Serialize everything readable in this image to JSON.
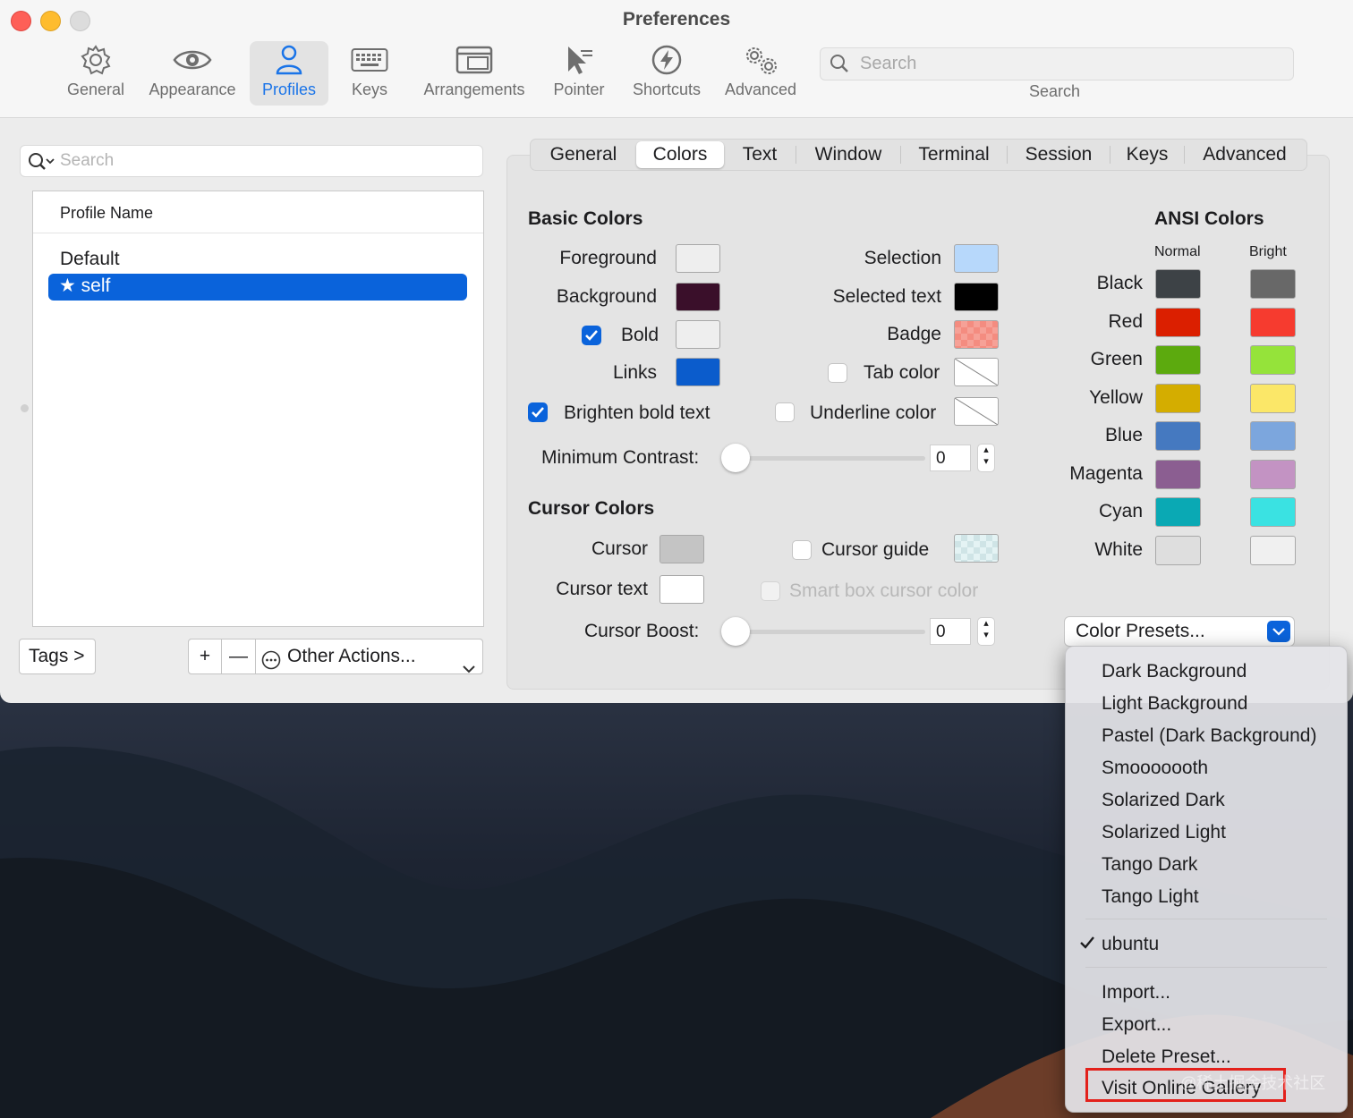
{
  "window": {
    "title": "Preferences"
  },
  "toolbar": {
    "items": [
      {
        "label": "General",
        "icon": "gear-icon"
      },
      {
        "label": "Appearance",
        "icon": "eye-icon"
      },
      {
        "label": "Profiles",
        "icon": "person-icon",
        "active": true
      },
      {
        "label": "Keys",
        "icon": "keyboard-icon"
      },
      {
        "label": "Arrangements",
        "icon": "window-icon"
      },
      {
        "label": "Pointer",
        "icon": "pointer-icon"
      },
      {
        "label": "Shortcuts",
        "icon": "lightning-icon"
      },
      {
        "label": "Advanced",
        "icon": "gears-icon"
      }
    ],
    "search_placeholder": "Search",
    "search_label": "Search"
  },
  "profiles": {
    "search_placeholder": "Search",
    "column_header": "Profile Name",
    "items": [
      "Default",
      "self"
    ],
    "selected": "self",
    "tags_button": "Tags >",
    "add_label": "+",
    "remove_label": "—",
    "other_actions": "Other Actions..."
  },
  "tabs": [
    "General",
    "Colors",
    "Text",
    "Window",
    "Terminal",
    "Session",
    "Keys",
    "Advanced"
  ],
  "selected_tab": "Colors",
  "basic_colors": {
    "heading": "Basic Colors",
    "foreground": {
      "label": "Foreground",
      "color": "#eeeeee"
    },
    "background": {
      "label": "Background",
      "color": "#3a0f2a"
    },
    "bold": {
      "label": "Bold",
      "checked": true,
      "color": "#eeeeee"
    },
    "links": {
      "label": "Links",
      "color": "#0b5ccc"
    },
    "selection": {
      "label": "Selection",
      "color": "#b7d8fb"
    },
    "selected_text": {
      "label": "Selected text",
      "color": "#000000"
    },
    "badge": {
      "label": "Badge",
      "color": "#f48c80"
    },
    "tab_color": {
      "label": "Tab color",
      "checked": false
    },
    "brighten_bold": {
      "label": "Brighten bold text",
      "checked": true
    },
    "underline_color": {
      "label": "Underline color",
      "checked": false
    },
    "min_contrast": {
      "label": "Minimum Contrast:",
      "value": "0"
    }
  },
  "cursor_colors": {
    "heading": "Cursor Colors",
    "cursor": {
      "label": "Cursor",
      "color": "#c4c4c4"
    },
    "cursor_text": {
      "label": "Cursor text",
      "color": "#ffffff"
    },
    "cursor_guide": {
      "label": "Cursor guide",
      "checked": false
    },
    "smart_box": {
      "label": "Smart box cursor color",
      "checked": false,
      "disabled": true
    },
    "cursor_boost": {
      "label": "Cursor Boost:",
      "value": "0"
    }
  },
  "ansi": {
    "heading": "ANSI Colors",
    "normal_label": "Normal",
    "bright_label": "Bright",
    "rows": [
      {
        "name": "Black",
        "normal": "#3d4246",
        "bright": "#686868"
      },
      {
        "name": "Red",
        "normal": "#db1f00",
        "bright": "#f63b2f"
      },
      {
        "name": "Green",
        "normal": "#5caa0e",
        "bright": "#95e33a"
      },
      {
        "name": "Yellow",
        "normal": "#d4ad00",
        "bright": "#fbe768"
      },
      {
        "name": "Blue",
        "normal": "#4579c0",
        "bright": "#7ca6dd"
      },
      {
        "name": "Magenta",
        "normal": "#8b5e91",
        "bright": "#c393c3"
      },
      {
        "name": "Cyan",
        "normal": "#0aa9b4",
        "bright": "#3ae2e2"
      },
      {
        "name": "White",
        "normal": "#dedede",
        "bright": "#f0f0f0"
      }
    ]
  },
  "color_presets": {
    "button_label": "Color Presets...",
    "menu": {
      "presets": [
        "Dark Background",
        "Light Background",
        "Pastel (Dark Background)",
        "Smooooooth",
        "Solarized Dark",
        "Solarized Light",
        "Tango Dark",
        "Tango Light"
      ],
      "custom": [
        "ubuntu"
      ],
      "checked": "ubuntu",
      "actions": [
        "Import...",
        "Export...",
        "Delete Preset...",
        "Visit Online Gallery"
      ],
      "highlighted": "Visit Online Gallery"
    }
  },
  "watermark": "@稀土掘金技术社区"
}
